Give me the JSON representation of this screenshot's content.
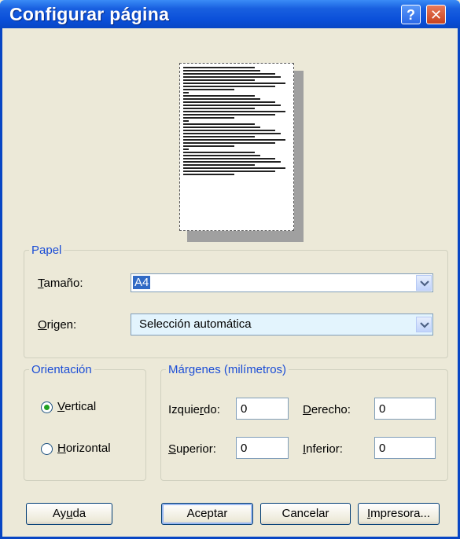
{
  "window": {
    "title": "Configurar página",
    "help_glyph": "?",
    "close_glyph": "✕"
  },
  "paper": {
    "legend": "Papel",
    "size_label": "Tamaño:",
    "size_value": "A4",
    "source_label": "Origen:",
    "source_value": "Selección automática"
  },
  "orientation": {
    "legend": "Orientación",
    "vertical_label": "Vertical",
    "horizontal_label": "Horizontal",
    "selected": "vertical"
  },
  "margins": {
    "legend": "Márgenes (milímetros)",
    "left_label": "Izquierdo:",
    "left_value": "0",
    "right_label": "Derecho:",
    "right_value": "0",
    "top_label": "Superior:",
    "top_value": "0",
    "bottom_label": "Inferior:",
    "bottom_value": "0"
  },
  "buttons": {
    "help": "Ayuda",
    "ok": "Aceptar",
    "cancel": "Cancelar",
    "printer": "Impresora..."
  }
}
